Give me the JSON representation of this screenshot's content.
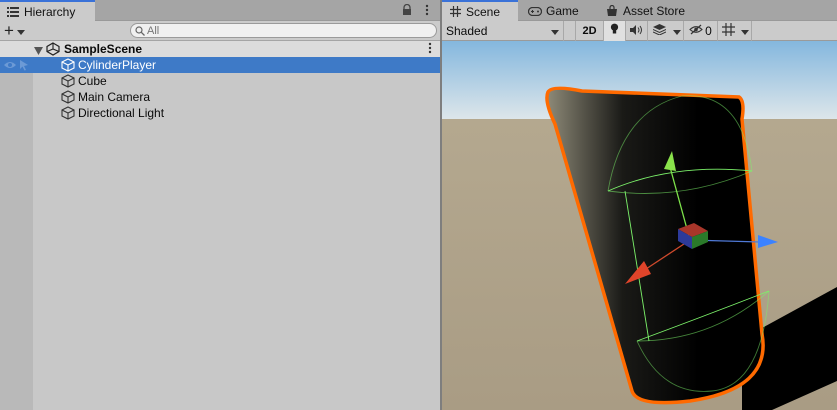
{
  "hierarchy": {
    "tab_label": "Hierarchy",
    "search_placeholder": "All",
    "add_label": "+",
    "scene_name": "SampleScene",
    "objects": [
      {
        "name": "CylinderPlayer",
        "selected": true
      },
      {
        "name": "Cube",
        "selected": false
      },
      {
        "name": "Main Camera",
        "selected": false
      },
      {
        "name": "Directional Light",
        "selected": false
      }
    ]
  },
  "scene_view": {
    "tabs": [
      {
        "label": "Scene",
        "icon": "hash-icon",
        "active": true
      },
      {
        "label": "Game",
        "icon": "gamepad-icon",
        "active": false
      },
      {
        "label": "Asset Store",
        "icon": "store-icon",
        "active": false
      }
    ],
    "toolbar": {
      "shading_mode": "Shaded",
      "mode_2d": "2D",
      "hidden_count": "0"
    }
  },
  "colors": {
    "selection": "#3e7ac7",
    "active_tab_accent": "#3a72d8",
    "outline": "#ff6a00",
    "sky": "#9cc8e6",
    "ground": "#b7aa91"
  }
}
